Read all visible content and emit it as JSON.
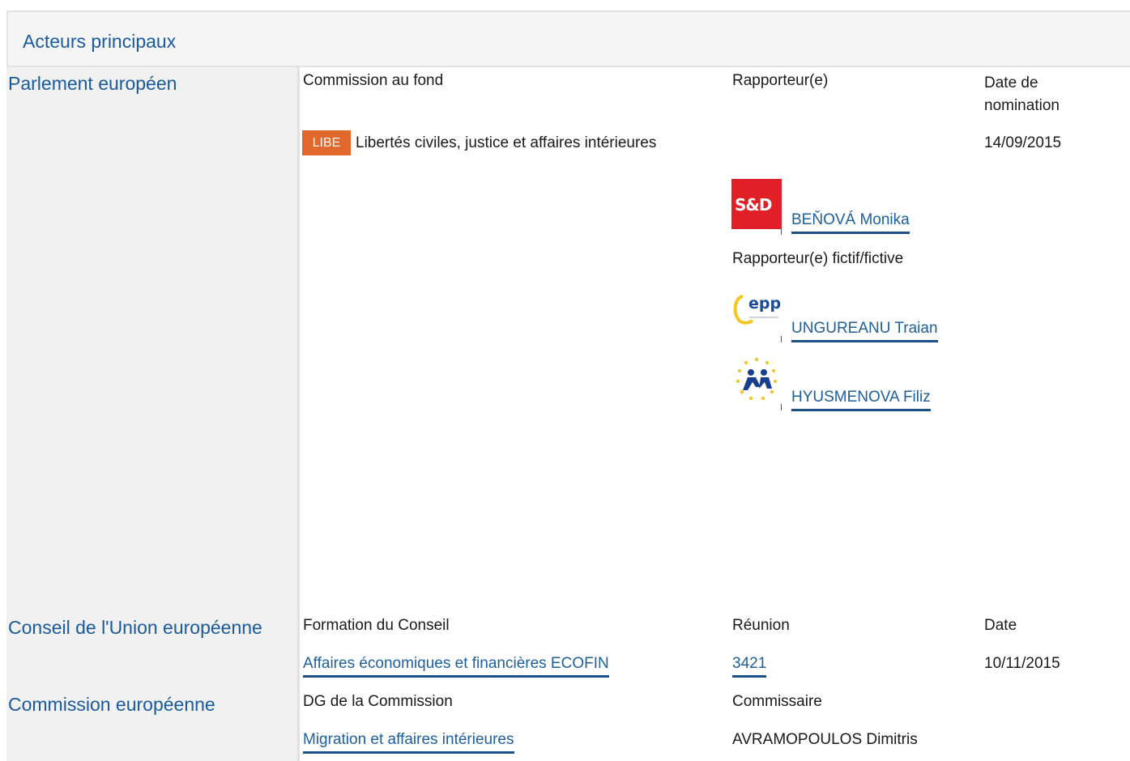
{
  "panel": {
    "title": "Acteurs principaux"
  },
  "parliament": {
    "section_label": "Parlement européen",
    "col_committee": "Commission au fond",
    "col_rapporteur": "Rapporteur(e)",
    "col_date": "Date de nomination",
    "committee_code": "LIBE",
    "committee_name": "Libertés civiles, justice et affaires intérieures",
    "appointment_date": "14/09/2015",
    "rapporteur": {
      "group_logo": "S&D",
      "name": "BEŇOVÁ Monika"
    },
    "shadow_label": "Rapporteur(e) fictif/fictive",
    "shadows": [
      {
        "group_logo": "epp",
        "name": "UNGUREANU Traian"
      },
      {
        "group_logo": "alde-stars",
        "name": "HYUSMENOVA Filiz"
      }
    ]
  },
  "council": {
    "section_label": "Conseil de l'Union européenne",
    "col_formation": "Formation du Conseil",
    "col_meeting": "Réunion",
    "col_date": "Date",
    "formation": "Affaires économiques et financières ECOFIN",
    "meeting": "3421",
    "date": "10/11/2015"
  },
  "commission": {
    "section_label": "Commission européenne",
    "col_dg": "DG de la Commission",
    "col_commissioner": "Commissaire",
    "dg": "Migration et affaires intérieures",
    "commissioner": "AVRAMOPOULOS Dimitris"
  },
  "colors": {
    "accent_link": "#1d5fa0",
    "badge_libe": "#e2672a",
    "sd_red": "#e01f26"
  }
}
